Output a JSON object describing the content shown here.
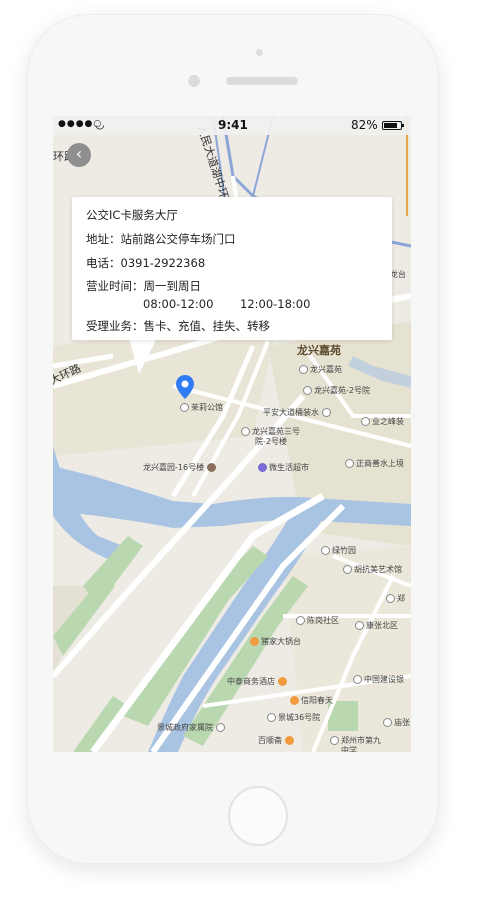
{
  "statusbar": {
    "carrier": "●●●●○",
    "time": "9:41",
    "battery": "82%",
    "battery_level": 0.82
  },
  "popup": {
    "name": "公交IC卡服务大厅",
    "address_label": "地址：",
    "address": "站前路公交停车场门口",
    "phone_label": "电话：",
    "phone": "0391-2922368",
    "hours_label": "营业时间：",
    "days": "周一到周日",
    "hours_am": "08:00-12:00",
    "hours_pm": "12:00-18:00",
    "services_label": "受理业务：",
    "services": "售卡、充值、挂失、转移"
  },
  "map": {
    "road_ring_vertical": "人民大道湖中环路",
    "road_ring_left_top": "环路",
    "road_ring_left": "大环路",
    "labels": {
      "longxing_jiayuan": "龙兴嘉苑",
      "longxing_jiayuan_poi": "龙兴嘉苑",
      "longxing_jiayuan_2": "龙兴嘉苑-2号院",
      "pingan": "平安大道桶装水",
      "yezhifeng": "业之峰装",
      "longxing_3": "龙兴嘉苑三号",
      "longxing_3b": "院-2号楼",
      "longxing_16": "龙兴嘉园-16号楼",
      "weisheng": "微生活超市",
      "zhengshang": "正商善水上境",
      "moli": "茉莉公馆",
      "longtai": "龙台",
      "lvzhuyuan": "绿竹园",
      "hukang": "胡抗美艺术馆",
      "zheng_right": "郑",
      "chengang": "陈岗社区",
      "kangbei": "康张北区",
      "zhujia": "猪家大锅台",
      "zhongtai": "中泰商务酒店",
      "jianshe": "中国建设银",
      "xinyang": "信阳春天",
      "jingcheng36": "景城36号院",
      "kangzhang": "庙张",
      "jingcheng_zf": "景城政府家属院",
      "baishun": "百顺斋",
      "zhengzhou9": "郑州市第九",
      "zhengzhou9b": "中学"
    }
  },
  "colors": {
    "map_bg": "#eeebe4",
    "water": "#a9c4e3",
    "green": "#b9d8b0",
    "road": "#ffffff",
    "pin": "#2f7cf6"
  },
  "icons": {
    "back": "back-arrow-icon",
    "pin": "location-pin-icon"
  }
}
